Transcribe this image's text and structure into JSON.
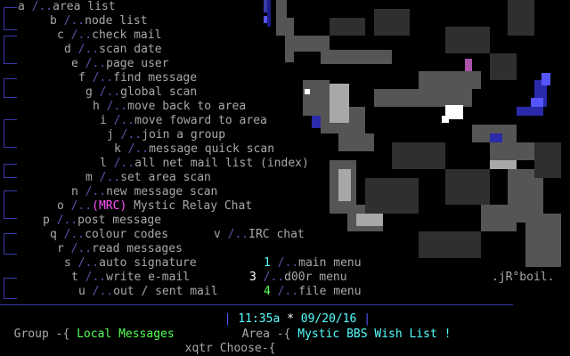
{
  "menu": [
    {
      "key": "a",
      "label": "area list"
    },
    {
      "key": "b",
      "label": "node list"
    },
    {
      "key": "c",
      "label": "check mail"
    },
    {
      "key": "d",
      "label": "scan date"
    },
    {
      "key": "e",
      "label": "page user"
    },
    {
      "key": "f",
      "label": "find message"
    },
    {
      "key": "g",
      "label": "global scan"
    },
    {
      "key": "h",
      "label": "move back to area"
    },
    {
      "key": "i",
      "label": "move foward to area"
    },
    {
      "key": "j",
      "label": "join a group"
    },
    {
      "key": "k",
      "label": "message quick scan"
    },
    {
      "key": "l",
      "label": "all net mail list (index)"
    },
    {
      "key": "m",
      "label": "set area scan"
    },
    {
      "key": "n",
      "label": "new message scan"
    },
    {
      "key": "o",
      "label_prefix": "(MRC)",
      "label": "Mystic Relay Chat"
    },
    {
      "key": "p",
      "label": "post message"
    },
    {
      "key": "q",
      "label": "colour codes"
    },
    {
      "key": "r",
      "label": "read messages"
    },
    {
      "key": "s",
      "label": "auto signature"
    },
    {
      "key": "t",
      "label": "write e-mail"
    },
    {
      "key": "u",
      "label": "out / sent mail"
    }
  ],
  "menu_right": [
    {
      "key": "v",
      "label": "IRC chat"
    },
    {
      "key": "1",
      "label": "main menu"
    },
    {
      "key": "3",
      "label": "d00r menu"
    },
    {
      "key": "4",
      "label": "file menu"
    }
  ],
  "separator": "/..",
  "status": {
    "time": "11:35a",
    "star": "*",
    "date": "09/20/16"
  },
  "group_label": "Group -{",
  "group_value": "Local Messages",
  "area_label": "Area -{",
  "area_value": "Mystic BBS Wish List !",
  "prompt_user": "xqtr",
  "prompt_label": "Choose-{",
  "signature": ".jR°boil.",
  "colors": {
    "background": "#000000",
    "accent": "#55ffff",
    "bracket": "#3a3aaa"
  }
}
